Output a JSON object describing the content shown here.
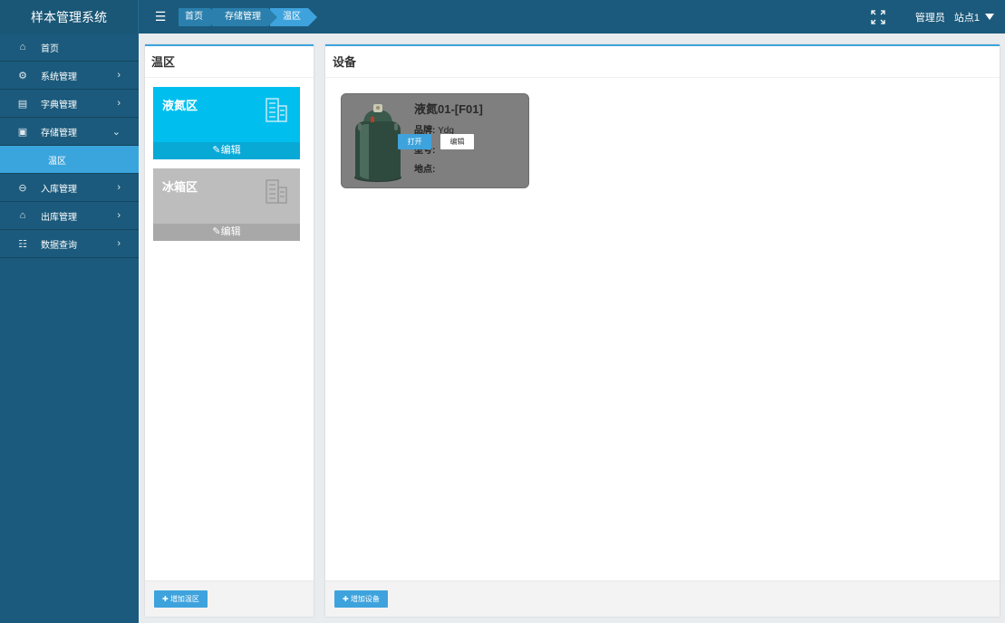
{
  "app": {
    "title": "样本管理系统"
  },
  "header": {
    "menu_icon": "menu-icon",
    "breadcrumbs": [
      "首页",
      "存储管理",
      "温区"
    ],
    "fullscreen_icon": "fullscreen-icon",
    "user": "管理员",
    "site": "站点1"
  },
  "sidebar": {
    "items": [
      {
        "label": "首页",
        "icon": "home-icon",
        "has_arrow": false
      },
      {
        "label": "系统管理",
        "icon": "gear-icon",
        "has_arrow": true
      },
      {
        "label": "字典管理",
        "icon": "book-icon",
        "has_arrow": true
      },
      {
        "label": "存储管理",
        "icon": "save-icon",
        "has_arrow": true,
        "expanded": true
      },
      {
        "label": "温区",
        "sub": true,
        "active": true
      },
      {
        "label": "入库管理",
        "icon": "inbound-icon",
        "has_arrow": true
      },
      {
        "label": "出库管理",
        "icon": "outbound-icon",
        "has_arrow": true
      },
      {
        "label": "数据查询",
        "icon": "query-icon",
        "has_arrow": true
      }
    ]
  },
  "zones_panel": {
    "title": "温区",
    "zones": [
      {
        "name": "液氮区",
        "edit_label": "编辑",
        "color": "#00bfee"
      },
      {
        "name": "冰箱区",
        "edit_label": "编辑",
        "color": "#bdbdbd"
      }
    ],
    "add_label": "增加温区"
  },
  "devices_panel": {
    "title": "设备",
    "device": {
      "name": "液氮01-[F01]",
      "brand_label": "品牌:",
      "brand_value": "Ydg",
      "model_label": "型号:",
      "model_value": "",
      "location_label": "地点:",
      "location_value": "",
      "open_label": "打开",
      "edit_label": "编辑"
    },
    "add_label": "增加设备"
  },
  "colors": {
    "header_bg": "#1b5a7c",
    "accent": "#3ea3dd",
    "zone_blue": "#00bfee",
    "zone_gray": "#bdbdbd"
  }
}
